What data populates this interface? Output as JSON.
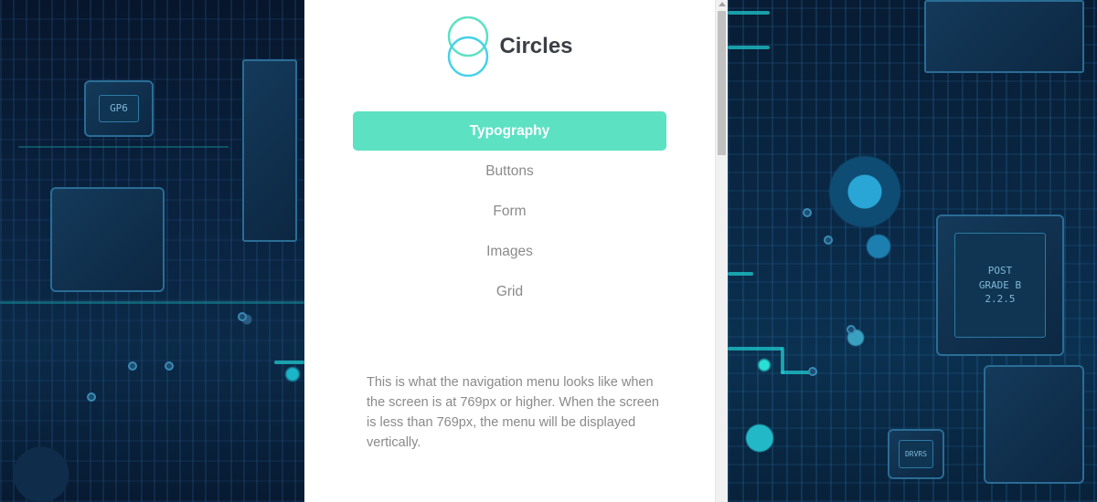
{
  "brand": {
    "name": "Circles",
    "logo_icon": "circles-logo-icon",
    "accent_color": "#5ce1c3"
  },
  "nav": {
    "items": [
      {
        "label": "Typography",
        "active": true
      },
      {
        "label": "Buttons",
        "active": false
      },
      {
        "label": "Form",
        "active": false
      },
      {
        "label": "Images",
        "active": false
      },
      {
        "label": "Grid",
        "active": false
      }
    ]
  },
  "note": {
    "text": "This is what the navigation menu looks like when the screen is at 769px or higher. When the screen is less than 769px, the menu will be displayed vertically."
  },
  "background": {
    "left_chip_text": "GP6",
    "right_chip_text": "POST\nGRADE B\n2.2.5",
    "small_chip_text": "DRVRS"
  }
}
